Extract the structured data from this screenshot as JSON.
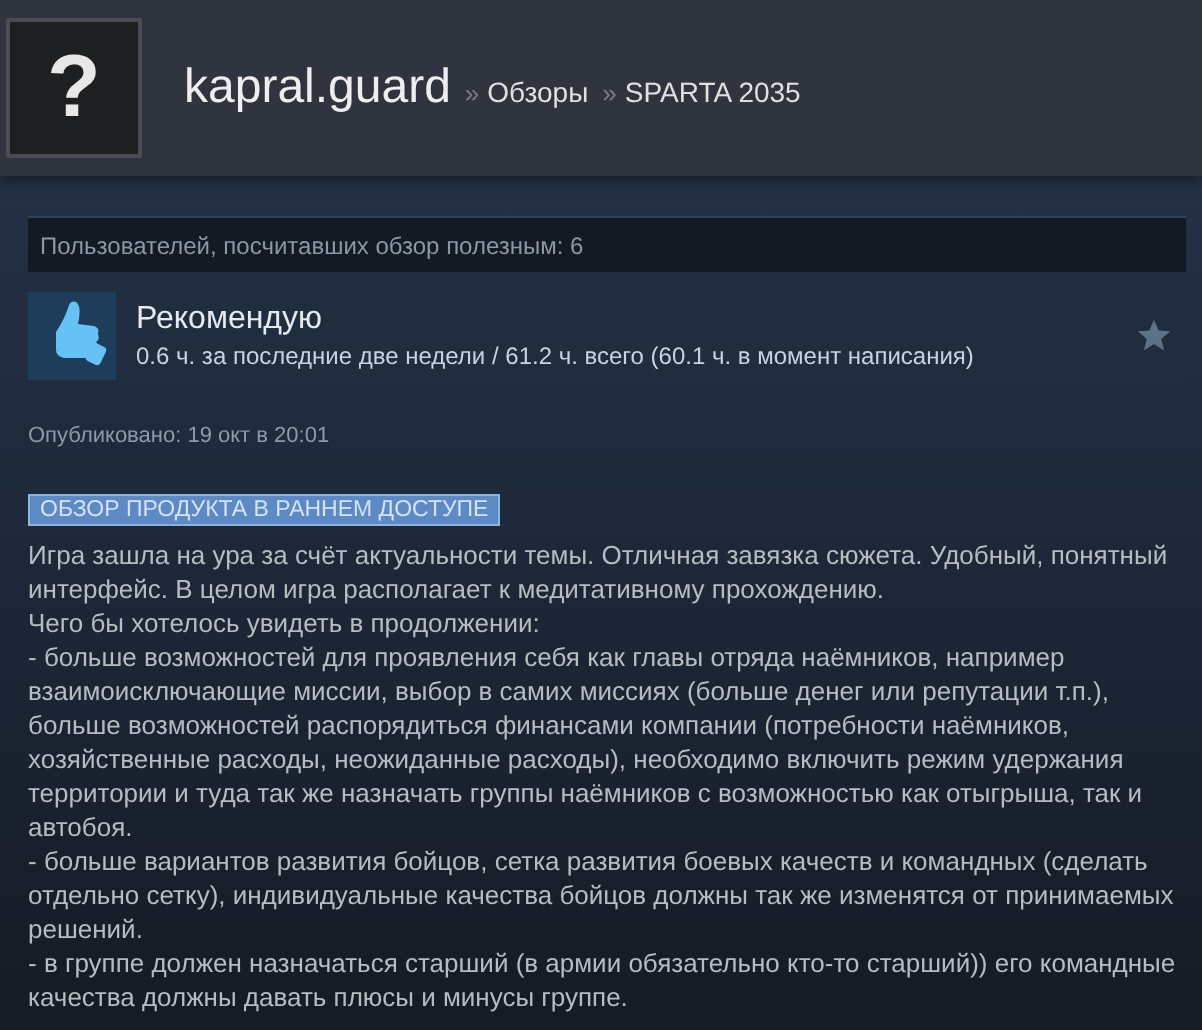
{
  "header": {
    "avatar_glyph": "?",
    "username": "kapral.guard",
    "breadcrumbs": [
      {
        "separator": "»",
        "label": "Обзоры"
      },
      {
        "separator": "»",
        "label": "SPARTA 2035"
      }
    ]
  },
  "helpful": "Пользователей, посчитавших обзор полезным: 6",
  "review": {
    "recommended": true,
    "title": "Рекомендую",
    "hours": "0.6 ч. за последние две недели / 61.2 ч. всего (60.1 ч. в момент написания)",
    "favorited": false
  },
  "published": "Опубликовано: 19 окт в 20:01",
  "badge": "ОБЗОР ПРОДУКТА В РАННЕМ ДОСТУПЕ",
  "body": [
    "Игра зашла на ура за счёт актуальности темы. Отличная завязка сюжета. Удобный, понятный интерфейс. В целом игра располагает к медитативному прохождению.",
    "Чего бы хотелось увидеть в продолжении:",
    "- больше возможностей для проявления себя как главы отряда наёмников, например взаимоисключающие миссии, выбор в самих миссиях (больше денег или репутации т.п.), больше возможностей распорядиться финансами компании (потребности наёмников, хозяйственные расходы, неожиданные расходы), необходимо включить режим удержания территории и туда так же назначать группы наёмников с возможностью как отыгрыша, так и автобоя.",
    "- больше вариантов развития бойцов, сетка развития боевых качеств и командных (сделать отдельно сетку), индивидуальные качества бойцов должны так же изменятся от принимаемых решений.",
    "- в группе должен назначаться старший (в армии обязательно кто-то старший)) его командные качества должны давать плюсы и минусы группе."
  ]
}
